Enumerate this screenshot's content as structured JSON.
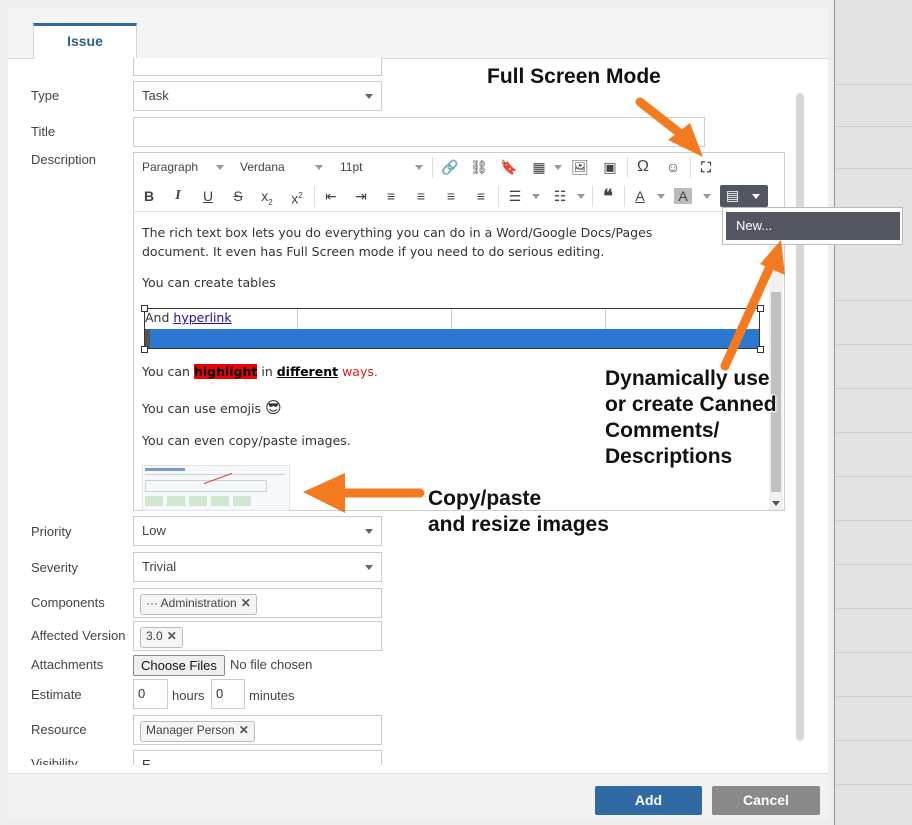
{
  "tab": {
    "label": "Issue"
  },
  "fields": {
    "type": {
      "label": "Type",
      "value": "Task"
    },
    "title": {
      "label": "Title",
      "value": ""
    },
    "description": {
      "label": "Description"
    },
    "priority": {
      "label": "Priority",
      "value": "Low"
    },
    "severity": {
      "label": "Severity",
      "value": "Trivial"
    },
    "components": {
      "label": "Components",
      "chip": "··· Administration"
    },
    "affected_version": {
      "label": "Affected Version",
      "chip": "3.0"
    },
    "attachments": {
      "label": "Attachments",
      "button": "Choose Files",
      "status": "No file chosen"
    },
    "estimate": {
      "label": "Estimate",
      "hours_value": "0",
      "hours_unit": "hours",
      "minutes_value": "0",
      "minutes_unit": "minutes"
    },
    "resource": {
      "label": "Resource",
      "chip": "Manager Person"
    },
    "visibility": {
      "label": "Visibility",
      "value": "E"
    }
  },
  "editor": {
    "toolbar": {
      "block_format": "Paragraph",
      "font_family": "Verdana",
      "font_size": "11pt"
    },
    "content": {
      "para1": "The rich text box lets you do everything you can do in a Word/Google Docs/Pages document. It even has Full Screen mode if you need to do serious editing.",
      "para2": "You can create tables",
      "table_text": "And ",
      "table_link": "hyperlink",
      "hl_prefix": "You can ",
      "hl_word": "highlight",
      "hl_mid": " in ",
      "hl_underline": "different",
      "hl_space": " ",
      "hl_red": "ways.",
      "emoji_line": "You can use emojis ",
      "emoji": "😎",
      "images_line": "You can even copy/paste images."
    },
    "canned_menu_item": "New..."
  },
  "annotations": {
    "full_screen": "Full Screen Mode",
    "canned_1": "Dynamically use",
    "canned_2": "or create Canned",
    "canned_3": "Comments/",
    "canned_4": "Descriptions",
    "copy_1": "Copy/paste",
    "copy_2": "and resize images"
  },
  "buttons": {
    "add": "Add",
    "cancel": "Cancel"
  },
  "colors": {
    "primary": "#2f6aa3",
    "secondary": "#8a8a8a",
    "annotation_arrow": "#f47a20",
    "table_fill": "#2a78d2",
    "highlight_bg": "#ee0000"
  }
}
